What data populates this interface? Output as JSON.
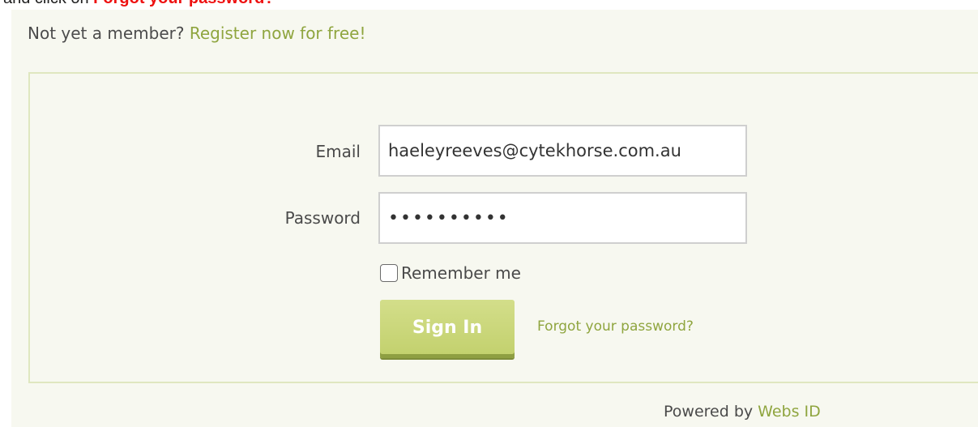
{
  "instruction": {
    "prefix": "and click on ",
    "highlight": "Forgot your password?"
  },
  "member_prompt": {
    "text": "Not yet a member? ",
    "register_link": "Register now for free!"
  },
  "form": {
    "email_label": "Email",
    "email_value": "haeleyreeves@cytekhorse.com.au",
    "password_label": "Password",
    "password_value": "••••••••••",
    "remember_label": "Remember me",
    "remember_checked": false,
    "signin_label": "Sign In",
    "forgot_link": "Forgot your password?"
  },
  "footer": {
    "powered_prefix": "Powered by ",
    "powered_link": "Webs ID"
  },
  "colors": {
    "accent_green": "#8fa53f",
    "button_green": "#c7d474",
    "highlight_red": "#ee1111",
    "panel_bg": "#f7f8f0",
    "box_border": "#dfe7c0"
  }
}
